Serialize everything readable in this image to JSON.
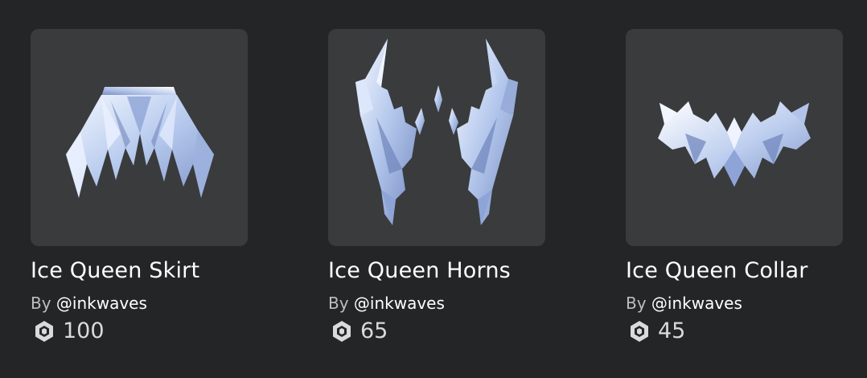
{
  "items": [
    {
      "name": "Ice Queen Skirt",
      "by_prefix": "By",
      "creator": "@inkwaves",
      "price": "100",
      "thumbnail_icon": "ice-skirt-icon"
    },
    {
      "name": "Ice Queen Horns",
      "by_prefix": "By",
      "creator": "@inkwaves",
      "price": "65",
      "thumbnail_icon": "ice-horns-icon"
    },
    {
      "name": "Ice Queen Collar",
      "by_prefix": "By",
      "creator": "@inkwaves",
      "price": "45",
      "thumbnail_icon": "ice-collar-icon"
    }
  ],
  "currency_icon": "robux-icon",
  "colors": {
    "background": "#232527",
    "thumbnail_bg": "#393b3d",
    "text_primary": "#ffffff",
    "text_secondary": "#bdbebe",
    "ice": "#c9d9f2"
  }
}
